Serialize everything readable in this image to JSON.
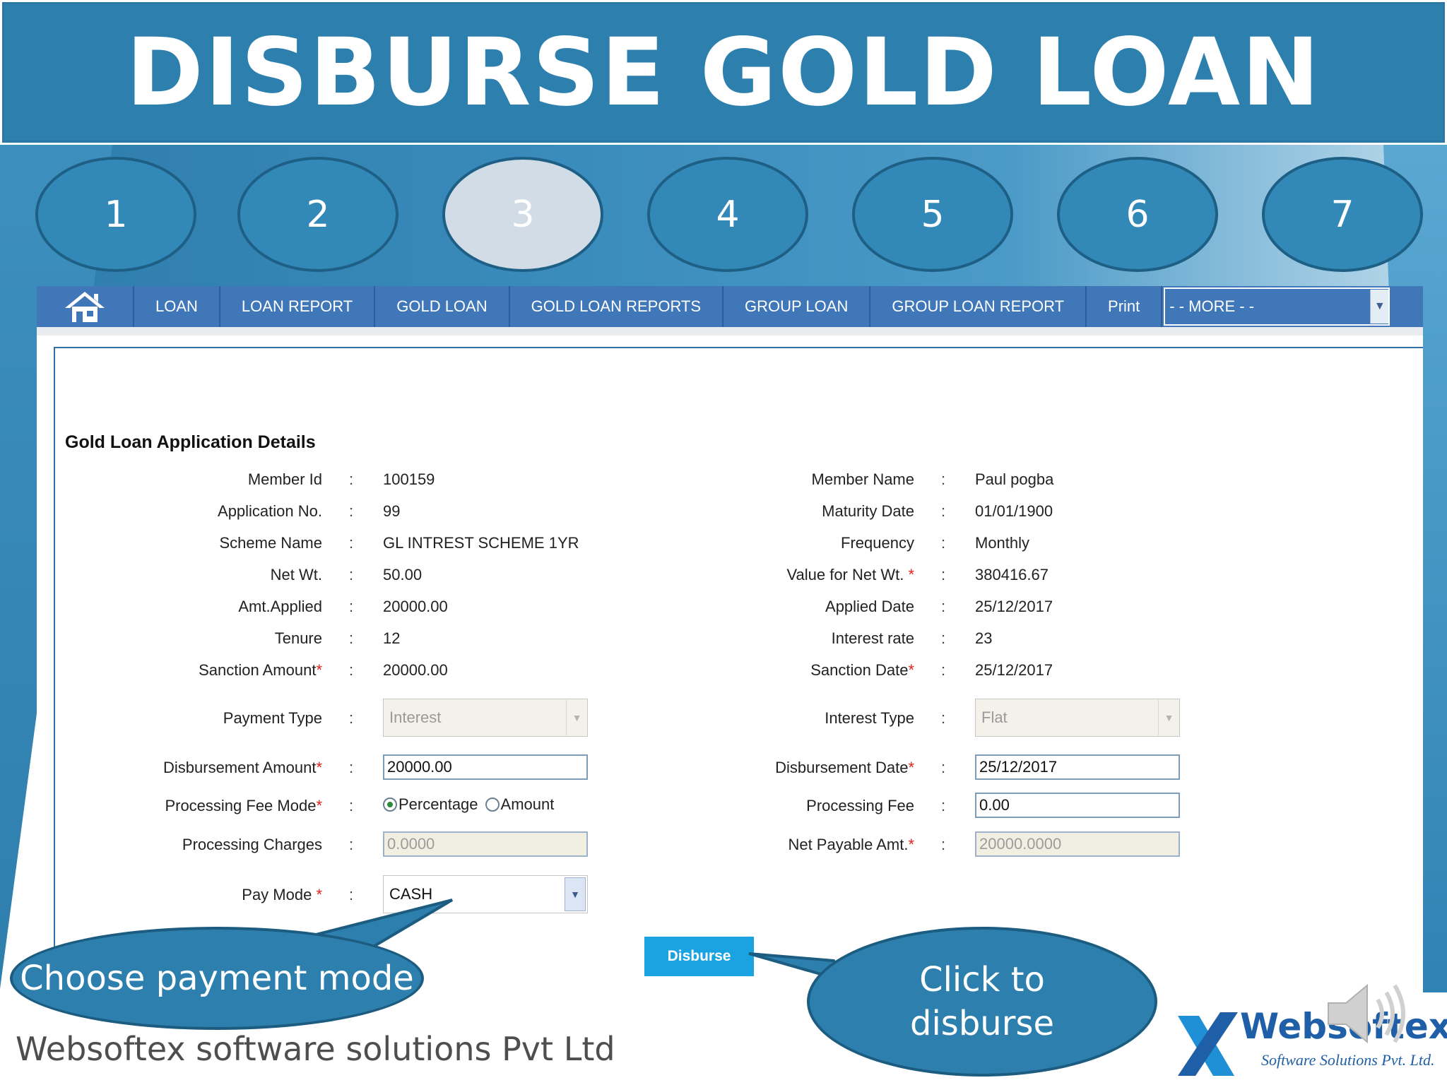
{
  "title": "DISBURSE GOLD LOAN",
  "steps": [
    {
      "label": "1",
      "active": false
    },
    {
      "label": "2",
      "active": false
    },
    {
      "label": "3",
      "active": true
    },
    {
      "label": "4",
      "active": false
    },
    {
      "label": "5",
      "active": false
    },
    {
      "label": "6",
      "active": false
    },
    {
      "label": "7",
      "active": false
    }
  ],
  "nav": {
    "home_icon": "home-icon",
    "items": [
      "LOAN",
      "LOAN REPORT",
      "GOLD LOAN",
      "GOLD LOAN REPORTS",
      "GROUP LOAN",
      "GROUP LOAN REPORT",
      "Print"
    ],
    "more": "- - MORE - -"
  },
  "form": {
    "heading": "Gold Loan Application Details",
    "left": [
      {
        "label": "Member Id",
        "value": "100159"
      },
      {
        "label": "Application No.",
        "value": "99"
      },
      {
        "label": "Scheme Name",
        "value": "GL INTREST SCHEME 1YR"
      },
      {
        "label": "Net Wt.",
        "value": "50.00"
      },
      {
        "label": "Amt.Applied",
        "value": "20000.00"
      },
      {
        "label": "Tenure",
        "value": "12"
      },
      {
        "label": "Sanction Amount",
        "value": "20000.00"
      }
    ],
    "right": [
      {
        "label": "Member Name",
        "value": "Paul pogba"
      },
      {
        "label": "Maturity Date",
        "value": "01/01/1900"
      },
      {
        "label": "Frequency",
        "value": "Monthly"
      },
      {
        "label": "Value for Net Wt. ",
        "value": "380416.67"
      },
      {
        "label": "Applied Date",
        "value": "25/12/2017"
      },
      {
        "label": "Interest rate",
        "value": "23"
      },
      {
        "label": "Sanction Date",
        "value": "25/12/2017"
      }
    ],
    "payment_type_label": "Payment Type",
    "payment_type_value": "Interest",
    "interest_type_label": "Interest Type",
    "interest_type_value": "Flat",
    "disbursement_amount_label": "Disbursement Amount",
    "disbursement_amount_value": "20000.00",
    "disbursement_date_label": "Disbursement Date",
    "disbursement_date_value": "25/12/2017",
    "processing_fee_mode_label": "Processing Fee Mode",
    "radio_percentage": "Percentage",
    "radio_amount": "Amount",
    "processing_fee_label": "Processing Fee",
    "processing_fee_value": "0.00",
    "processing_charges_label": "Processing Charges",
    "processing_charges_value": "0.0000",
    "net_payable_label": "Net Payable Amt.",
    "net_payable_value": "20000.0000",
    "pay_mode_label": "Pay Mode ",
    "pay_mode_value": "CASH",
    "required_mark": "*",
    "colon": ":",
    "disburse_button": "Disburse"
  },
  "callouts": {
    "left": "Choose payment mode",
    "right": "Click to disburse"
  },
  "footer": "Websoftex software solutions Pvt Ltd",
  "logo": {
    "name": "Websoftex",
    "tagline": "Software Solutions Pvt. Ltd."
  },
  "colors": {
    "banner": "#2d80ad",
    "nav": "#3f77b9",
    "button": "#1aa3e0",
    "required": "#e0231c"
  }
}
